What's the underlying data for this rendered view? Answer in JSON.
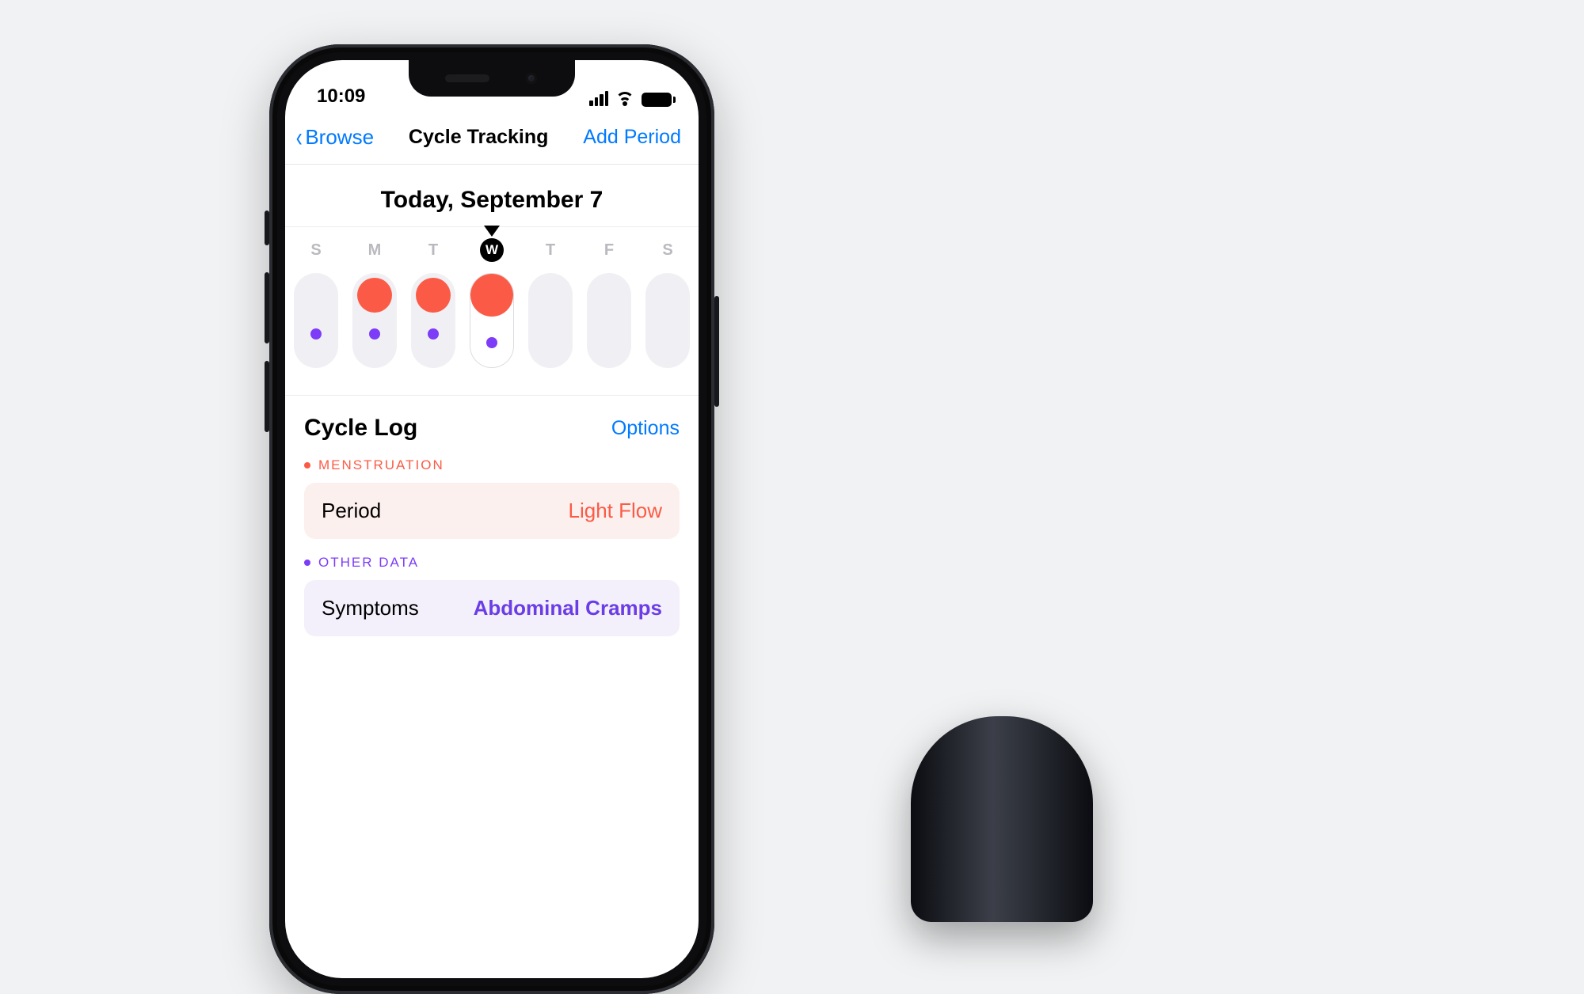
{
  "status": {
    "time": "10:09"
  },
  "nav": {
    "back_label": "Browse",
    "title": "Cycle Tracking",
    "action_label": "Add Period"
  },
  "today_label": "Today, September 7",
  "days": [
    {
      "letter": "S",
      "period": false,
      "note": true,
      "selected": false
    },
    {
      "letter": "M",
      "period": true,
      "note": true,
      "selected": false
    },
    {
      "letter": "T",
      "period": true,
      "note": true,
      "selected": false
    },
    {
      "letter": "W",
      "period": true,
      "note": true,
      "selected": true
    },
    {
      "letter": "T",
      "period": false,
      "note": false,
      "selected": false
    },
    {
      "letter": "F",
      "period": false,
      "note": false,
      "selected": false
    },
    {
      "letter": "S",
      "period": false,
      "note": false,
      "selected": false
    }
  ],
  "log": {
    "section_title": "Cycle Log",
    "options_label": "Options",
    "menstruation_label": "MENSTRUATION",
    "other_label": "OTHER DATA",
    "period_row": {
      "label": "Period",
      "value": "Light Flow"
    },
    "symptoms_row": {
      "label": "Symptoms",
      "value": "Abdominal Cramps"
    }
  }
}
